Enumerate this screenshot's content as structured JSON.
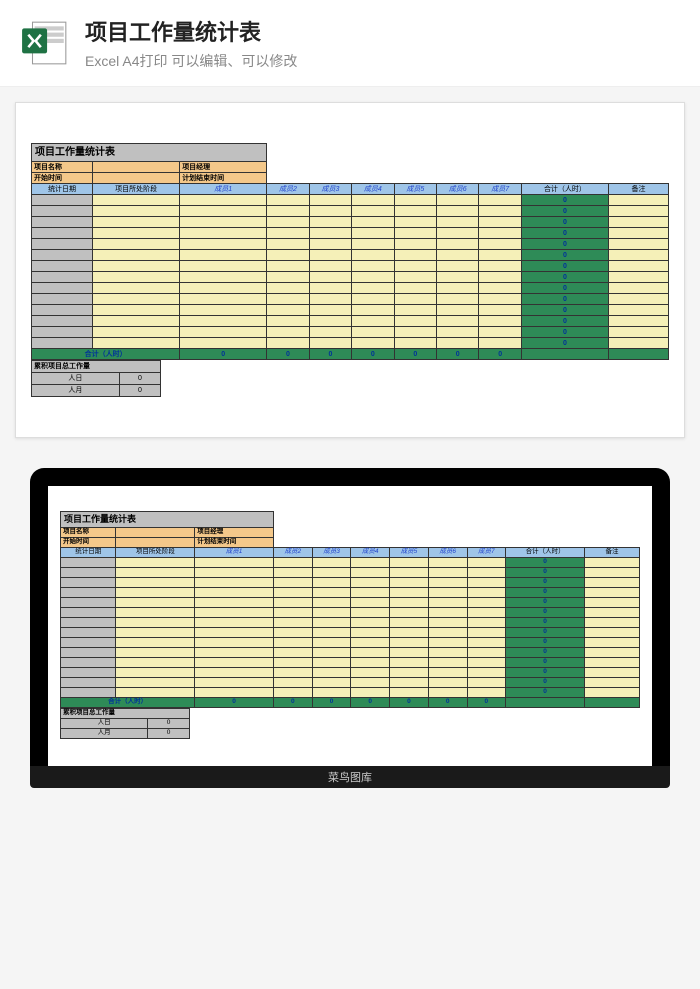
{
  "header": {
    "title": "项目工作量统计表",
    "subtitle": "Excel A4打印 可以编辑、可以修改"
  },
  "sheet": {
    "title": "项目工作量统计表",
    "labels": {
      "project_name": "项目名称",
      "project_manager": "项目经理",
      "start_time": "开始时间",
      "plan_end_time": "计划结束时间"
    },
    "columns": {
      "stat_date": "统计日期",
      "phase": "项目所处阶段",
      "members": [
        "成员1",
        "成员2",
        "成员3",
        "成员4",
        "成员5",
        "成员6",
        "成员7"
      ],
      "total": "合计（人时）",
      "remark": "备注"
    },
    "total_row_label": "合计（人时）",
    "total_row_values": [
      "0",
      "0",
      "0",
      "0",
      "0",
      "0",
      "0",
      ""
    ],
    "green_col_values": [
      "0",
      "0",
      "0",
      "0",
      "0",
      "0",
      "0",
      "0",
      "0",
      "0",
      "0",
      "0",
      "0",
      "0"
    ],
    "summary": {
      "title": "累积项目总工作量",
      "rows": [
        {
          "label": "人日",
          "value": "0"
        },
        {
          "label": "人月",
          "value": "0"
        }
      ]
    }
  },
  "watermark": "菜鸟图库"
}
